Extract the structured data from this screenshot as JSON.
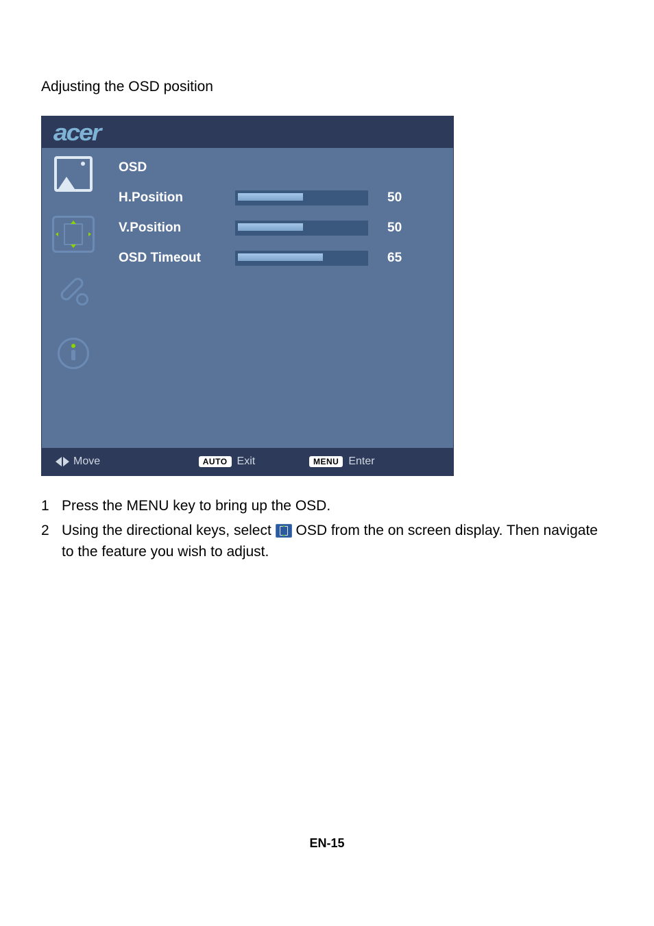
{
  "heading": "Adjusting the OSD position",
  "logo": "acer",
  "osd": {
    "title": "OSD",
    "rows": [
      {
        "label": "H.Position",
        "value": "50",
        "percent": 50
      },
      {
        "label": "V.Position",
        "value": "50",
        "percent": 50
      },
      {
        "label": "OSD Timeout",
        "value": "65",
        "percent": 65
      }
    ]
  },
  "footer": {
    "move": "Move",
    "auto_badge": "AUTO",
    "exit": "Exit",
    "menu_badge": "MENU",
    "enter": "Enter"
  },
  "steps": {
    "s1_num": "1",
    "s1": "Press the MENU key to bring up the OSD.",
    "s2_num": "2",
    "s2a": "Using the directional keys, select ",
    "s2b": " OSD from the on screen display. Then navigate to the feature you wish to adjust."
  },
  "page_number": "EN-15"
}
